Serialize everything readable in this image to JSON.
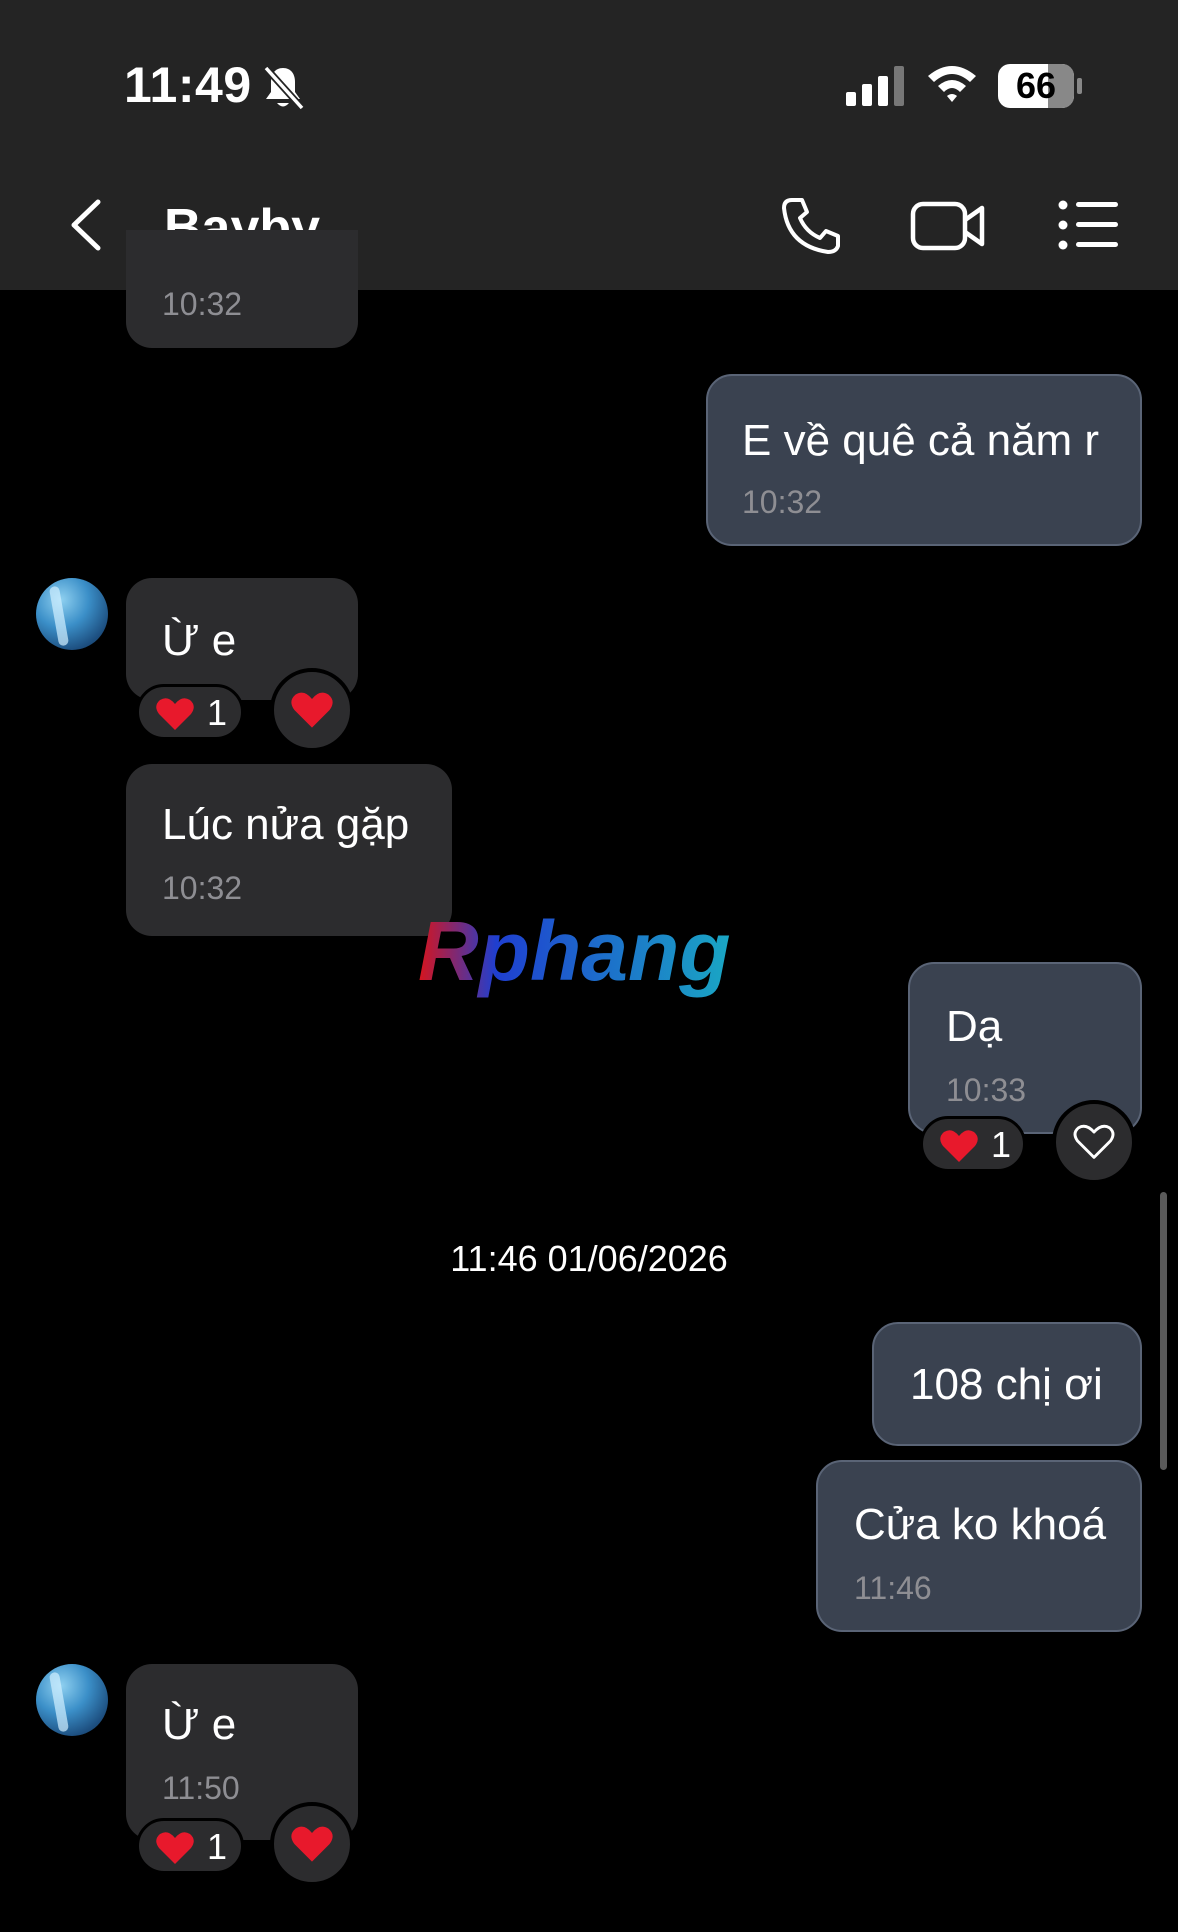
{
  "status_bar": {
    "time": "11:49",
    "battery": "66"
  },
  "header": {
    "title": "Bayby"
  },
  "messages": [
    {
      "time": "10:32"
    },
    {
      "text": "E về quê cả năm r",
      "time": "10:32"
    },
    {
      "text": "Ừ e",
      "reaction_count": "1"
    },
    {
      "text": "Lúc nửa gặp",
      "time": "10:32"
    },
    {
      "text": "Dạ",
      "time": "10:33",
      "reaction_count": "1"
    },
    {
      "text": "108 chị ơi"
    },
    {
      "text": "Cửa ko khoá",
      "time": "11:46"
    },
    {
      "text": "Ừ e",
      "time": "11:50",
      "reaction_count": "1"
    }
  ],
  "date_separator": "11:46 01/06/2026",
  "watermark": "Rphang",
  "colors": {
    "header_bg": "#242424",
    "incoming_bubble": "#2c2c2e",
    "outgoing_bubble": "#3a4250",
    "heart": "#e8192c"
  }
}
